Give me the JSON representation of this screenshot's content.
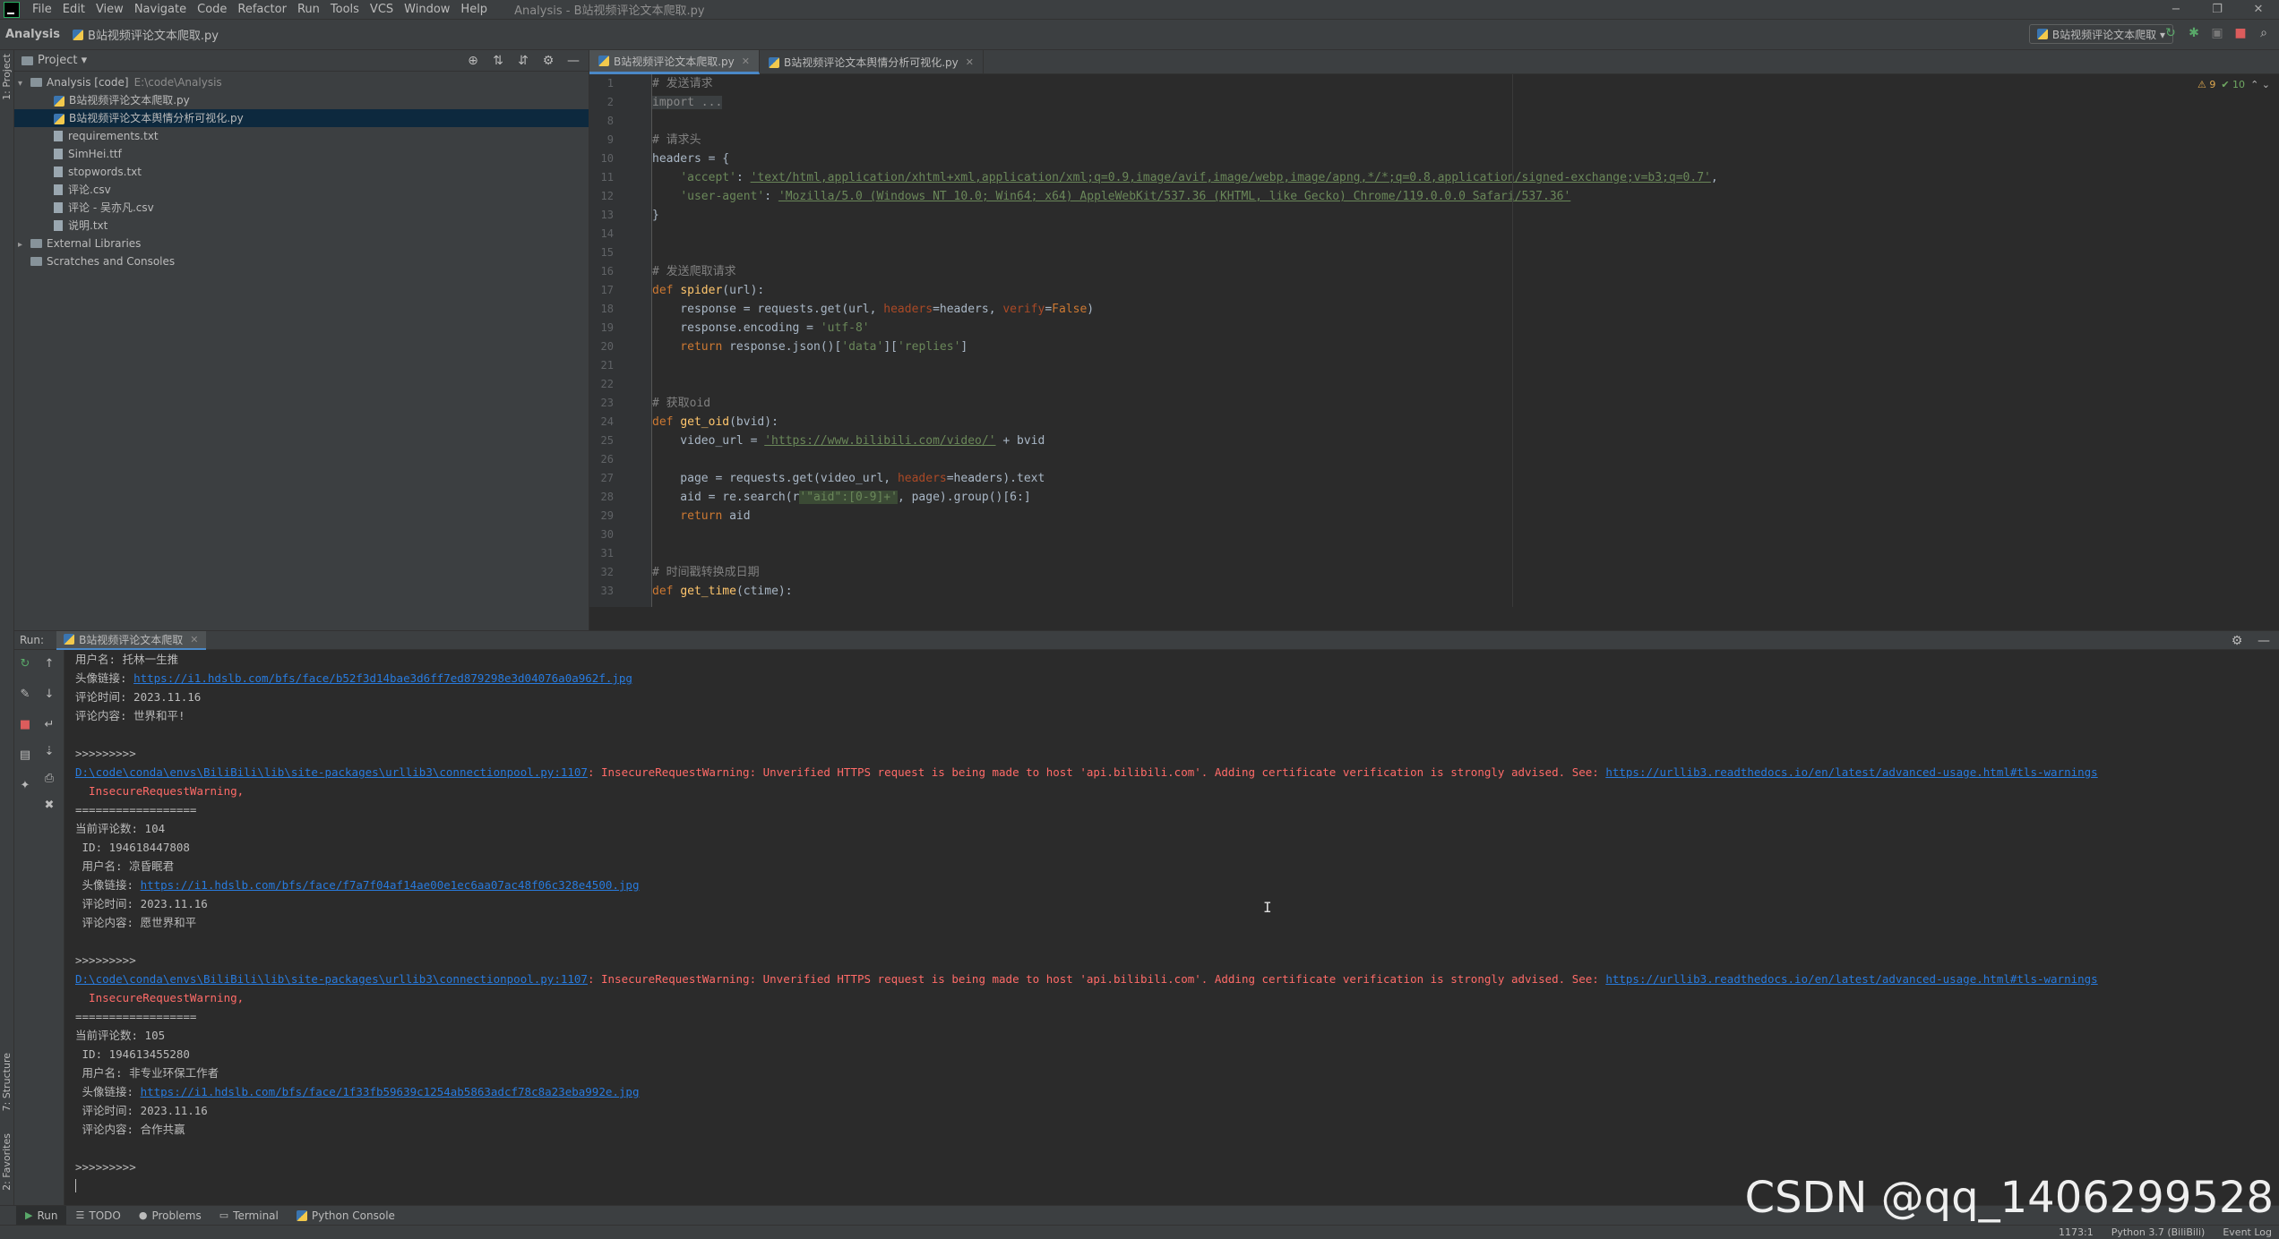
{
  "menubar": {
    "items": [
      "File",
      "Edit",
      "View",
      "Navigate",
      "Code",
      "Refactor",
      "Run",
      "Tools",
      "VCS",
      "Window",
      "Help"
    ],
    "window_title": "Analysis - B站视频评论文本爬取.py",
    "controls": [
      "−",
      "❐",
      "✕"
    ]
  },
  "navbar": {
    "project": "Analysis",
    "file": "B站视频评论文本爬取.py",
    "run_config": "B站视频评论文本爬取 ▾"
  },
  "sidestrip": {
    "project_label": "1: Project",
    "structure_label": "7: Structure",
    "favorites_label": "2: Favorites"
  },
  "project_panel": {
    "title": "Project ▾",
    "root": {
      "name": "Analysis [code]",
      "path": "E:\\code\\Analysis"
    },
    "files": [
      "B站视频评论文本爬取.py",
      "B站视频评论文本舆情分析可视化.py",
      "requirements.txt",
      "SimHei.ttf",
      "stopwords.txt",
      "评论.csv",
      "评论 - 吴亦凡.csv",
      "说明.txt"
    ],
    "selected_index": 1,
    "external": "External Libraries",
    "scratches": "Scratches and Consoles"
  },
  "editor": {
    "tabs": [
      {
        "label": "B站视频评论文本爬取.py",
        "active": true
      },
      {
        "label": "B站视频评论文本舆情分析可视化.py",
        "active": false
      }
    ],
    "inspections": {
      "warnings": "⚠ 9",
      "ok": "✔ 10",
      "nav": "⌃ ⌄"
    },
    "line_numbers": [
      "1",
      "2",
      "8",
      "9",
      "10",
      "11",
      "12",
      "13",
      "14",
      "15",
      "16",
      "17",
      "18",
      "19",
      "20",
      "21",
      "22",
      "23",
      "24",
      "25",
      "26",
      "27",
      "28",
      "29",
      "30",
      "31",
      "32",
      "33"
    ],
    "code": {
      "l1": "# 发送请求",
      "l2": "import ...",
      "l9": "# 请求头",
      "l10": "headers = {",
      "l11_key": "'accept'",
      "l11_val": "'text/html,application/xhtml+xml,application/xml;q=0.9,image/avif,image/webp,image/apng,*/*;q=0.8,application/signed-exchange;v=b3;q=0.7'",
      "l12_key": "'user-agent'",
      "l12_val": "'Mozilla/5.0 (Windows NT 10.0; Win64; x64) AppleWebKit/537.36 (KHTML, like Gecko) Chrome/119.0.0.0 Safari/537.36'",
      "l13": "}",
      "l16": "# 发送爬取请求",
      "l17_def": "def",
      "l17_name": "spider",
      "l17_args": "(url):",
      "l18_a": "    response = requests.get(url, ",
      "l18_k1": "headers",
      "l18_b": "=headers, ",
      "l18_k2": "verify",
      "l18_c": "=",
      "l18_false": "False",
      "l18_d": ")",
      "l19_a": "    response.encoding = ",
      "l19_s": "'utf-8'",
      "l20_ret": "    return",
      "l20_a": " response.json()[",
      "l20_s1": "'data'",
      "l20_b": "][",
      "l20_s2": "'replies'",
      "l20_c": "]",
      "l23": "# 获取oid",
      "l24_def": "def",
      "l24_name": "get_oid",
      "l24_args": "(bvid):",
      "l25_a": "    video_url = ",
      "l25_s": "'https://www.bilibili.com/video/'",
      "l25_b": " + bvid",
      "l27_a": "    page = requests.get(video_url, ",
      "l27_k": "headers",
      "l27_b": "=headers).text",
      "l28_a": "    aid = re.search(r",
      "l28_s": "'\"aid\":[0-9]+'",
      "l28_b": ", page).group()[6:]",
      "l29_ret": "    return",
      "l29_a": " aid",
      "l32": "# 时间戳转换成日期",
      "l33_def": "def",
      "l33_name": "get_time",
      "l33_args": "(ctime):"
    }
  },
  "run": {
    "label": "Run:",
    "tab": "B站视频评论文本爬取",
    "console": {
      "c1_label": "用户名: ",
      "c1_val": "托林一生推",
      "c2_label": "头像链接: ",
      "c2_url": "https://i1.hdslb.com/bfs/face/b52f3d14bae3d6ff7ed879298e3d04076a0a962f.jpg",
      "c3": "评论时间: 2023.11.16",
      "c4": "评论内容: 世界和平!",
      "sep1": ">>>>>>>>>",
      "warn_path": "D:\\code\\conda\\envs\\BiliBili\\lib\\site-packages\\urllib3\\connectionpool.py:1107",
      "warn_text": ": InsecureRequestWarning: Unverified HTTPS request is being made to host 'api.bilibili.com'. Adding certificate verification is strongly advised. See: ",
      "warn_url": "https://urllib3.readthedocs.io/en/latest/advanced-usage.html#tls-warnings",
      "warn_name": "  InsecureRequestWarning,",
      "eq": "==================",
      "count1": "当前评论数: 104",
      "id1": " ID: 194618447808",
      "user1": " 用户名: 凉昏眠君",
      "avatar_label": " 头像链接: ",
      "avatar1": "https://i1.hdslb.com/bfs/face/f7a7f04af14ae00e1ec6aa07ac48f06c328e4500.jpg",
      "time1": " 评论时间: 2023.11.16",
      "content1": " 评论内容: 愿世界和平",
      "sep2": ">>>>>>>>>",
      "count2": "当前评论数: 105",
      "id2": " ID: 194613455280",
      "user2": " 用户名: 非专业环保工作者",
      "avatar2": "https://i1.hdslb.com/bfs/face/1f33fb59639c1254ab5863adcf78c8a23eba992e.jpg",
      "time2": " 评论时间: 2023.11.16",
      "content2": " 评论内容: 合作共赢",
      "sep3": ">>>>>>>>>"
    }
  },
  "bottom_tabs": [
    "Run",
    "TODO",
    "Problems",
    "Terminal",
    "Python Console"
  ],
  "status": {
    "position": "1173:1",
    "interpreter": "Python 3.7 (BiliBili)",
    "event_log": "Event Log"
  },
  "watermark": "CSDN @qq_1406299528"
}
